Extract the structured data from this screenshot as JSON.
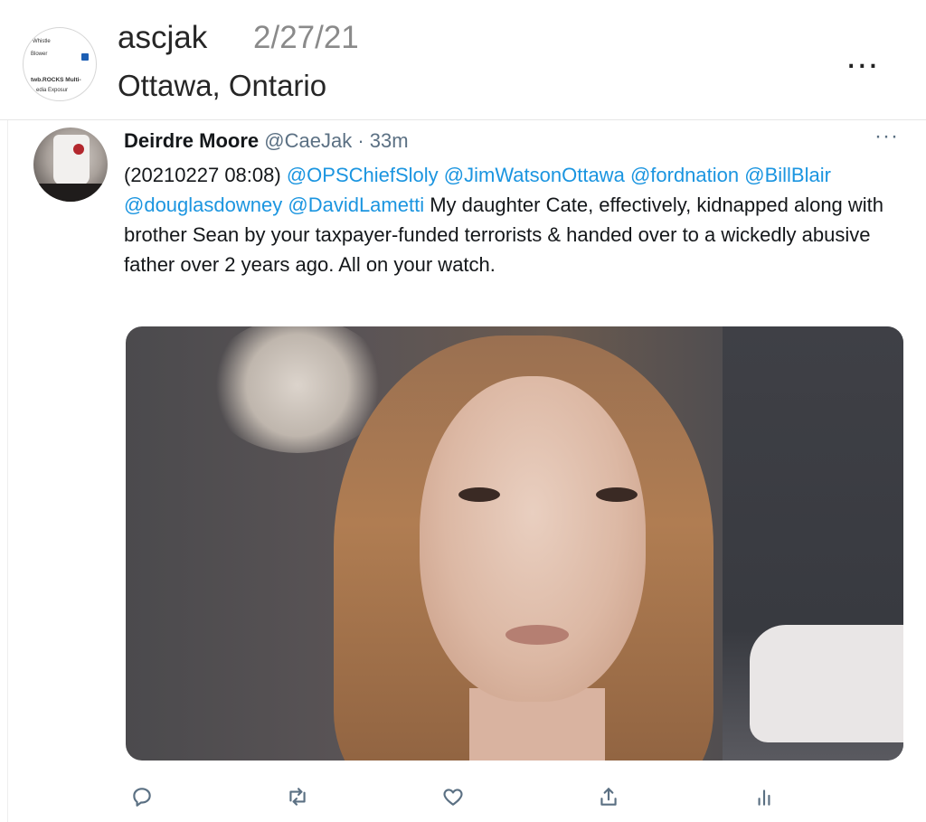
{
  "post": {
    "avatar_text": [
      "Whistle",
      "Blower",
      "twb.ROCKS Multi-",
      "edia Exposur"
    ],
    "username": "ascjak",
    "date": "2/27/21",
    "location": "Ottawa, Ontario",
    "more_label": "..."
  },
  "tweet": {
    "author_name": "Deirdre Moore",
    "author_handle": "@CaeJak",
    "separator": "·",
    "time_ago": "33m",
    "more_label": "···",
    "text_prefix": "(20210227 08:08) ",
    "mentions": [
      "@OPSChiefSloly",
      "@JimWatsonOttawa",
      "@fordnation",
      "@BillBlair",
      "@douglasdowney",
      "@DavidLametti"
    ],
    "text_body": " My daughter Cate, effectively, kidnapped along with brother Sean by your taxpayer-funded terrorists & handed over to a wickedly abusive father over 2 years ago. All on your watch.",
    "actions": [
      "reply-icon",
      "retweet-icon",
      "like-icon",
      "share-icon",
      "analytics-icon"
    ]
  },
  "colors": {
    "mention": "#1b95e0",
    "muted": "#5b7083",
    "text": "#14171a"
  }
}
